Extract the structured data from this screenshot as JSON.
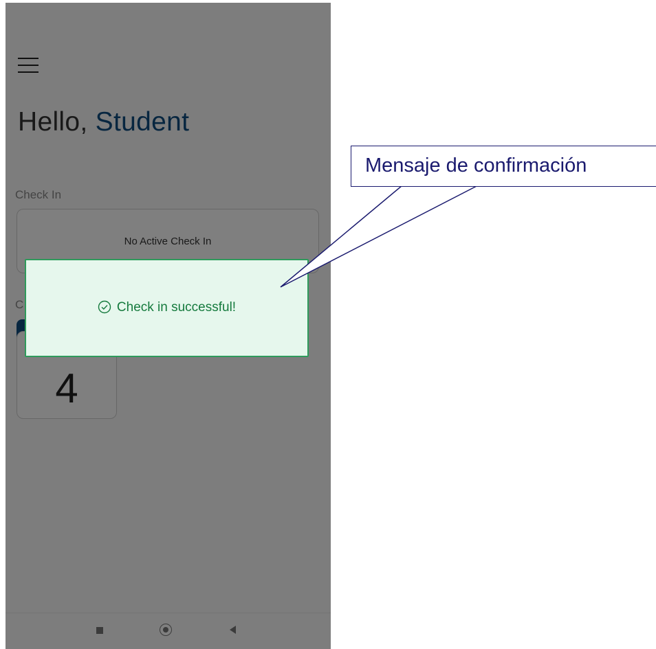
{
  "screen": {
    "greeting_prefix": "Hello,",
    "user_name": "Student",
    "checkin_label": "Check In",
    "checkin_status": "No Active Check In",
    "count_label": "C",
    "count_value": "4"
  },
  "toast": {
    "message": "Check in successful!",
    "icon": "check-circle-icon",
    "bg_color": "#e6f7ed",
    "accent_color": "#2e9a5b"
  },
  "navbar": {
    "icons": [
      "recents-square-icon",
      "home-circle-icon",
      "back-triangle-icon"
    ]
  },
  "callout": {
    "text": "Mensaje de confirmación",
    "color": "#1a1a6e"
  }
}
